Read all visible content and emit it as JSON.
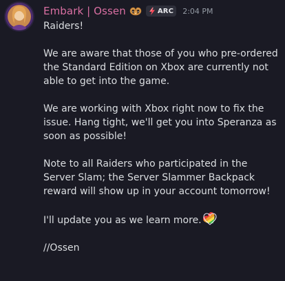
{
  "author": {
    "name": "Embark | Ossen",
    "badge_icon": "pretzel-icon",
    "tag_icon": "lightning-bolt-icon",
    "tag_label": "ARC",
    "name_color": "#d96fa2"
  },
  "timestamp": "2:04 PM",
  "message": {
    "greeting": "Raiders!",
    "paragraph1": "We are aware that those of you who pre-ordered the Standard Edition on Xbox are currently not able to get into the game.",
    "paragraph2": "We are working with Xbox right now to fix the issue. Hang tight, we'll get you into Speranza as soon as possible!",
    "paragraph3": "Note to all Raiders who participated in the Server Slam; the Server Slammer Backpack reward will show up in your account tomorrow!",
    "paragraph4": "I'll update you as we learn more.",
    "paragraph4_emoji": "rainbow-heart-icon",
    "signoff": "//Ossen"
  }
}
